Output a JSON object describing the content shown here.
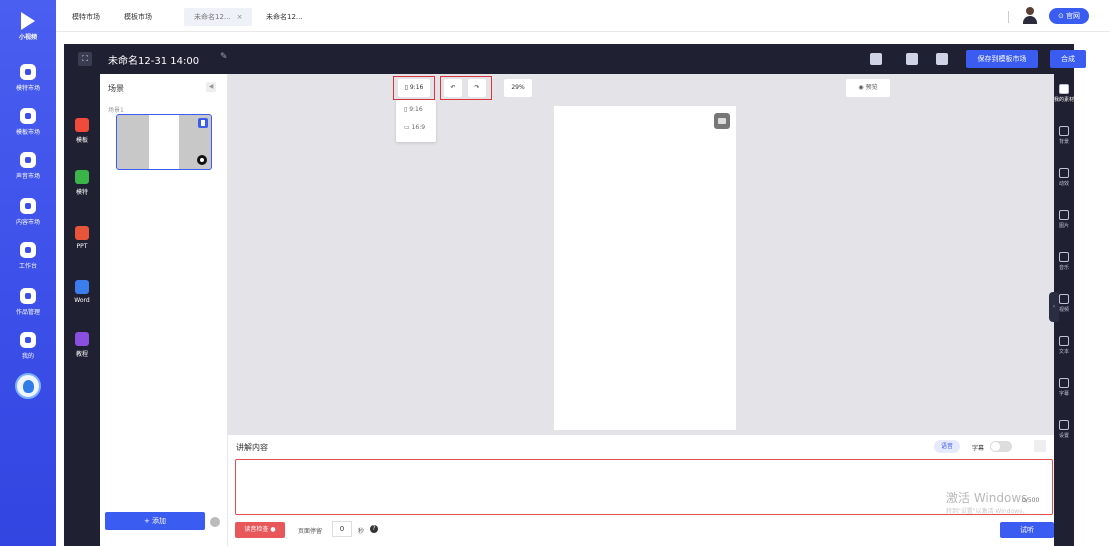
{
  "left_nav": {
    "logo_text": "小视频",
    "items": [
      {
        "label": "模特市场",
        "icon": "model-icon"
      },
      {
        "label": "模板市场",
        "icon": "template-icon"
      },
      {
        "label": "声音市场",
        "icon": "voice-icon"
      },
      {
        "label": "内容市场",
        "icon": "content-icon"
      },
      {
        "label": "工作台",
        "icon": "workbench-icon"
      },
      {
        "label": "作品管理",
        "icon": "works-icon"
      },
      {
        "label": "我的",
        "icon": "profile-icon"
      }
    ]
  },
  "tabs": [
    {
      "label": "模特市场"
    },
    {
      "label": "模板市场"
    },
    {
      "label": "未命名12...",
      "close": "×",
      "active": true
    },
    {
      "label": "未命名12..."
    }
  ],
  "header": {
    "official_label": "官网"
  },
  "editor": {
    "title": "未命名12-31 14:00",
    "save_label": "保存到模板市场",
    "compose_label": "合成"
  },
  "categories": [
    {
      "label": "模板",
      "color": "#f04b3a"
    },
    {
      "label": "模特",
      "color": "#3bb54a"
    },
    {
      "label": "PPT",
      "color": "#e8543a"
    },
    {
      "label": "Word",
      "color": "#3b7ded"
    },
    {
      "label": "教程",
      "color": "#8a4fe0"
    }
  ],
  "scenes": {
    "title": "场景",
    "scene_label": "场景1",
    "add_label": "+ 添加"
  },
  "canvas": {
    "ratio_current": "9:16",
    "ratio_options": [
      "9:16",
      "16:9"
    ],
    "zoom": "29%",
    "preview_label": "预览"
  },
  "narration": {
    "title": "讲解内容",
    "voice_label": "语音",
    "subtitle_label": "字幕",
    "counter": "0/500",
    "watermark_line1": "激活 Windows",
    "watermark_line2": "转到\"设置\"以激活 Windows。",
    "check_label": "读音检查",
    "pause_label": "页面停留",
    "pause_value": "0",
    "seconds_label": "秒",
    "listen_label": "试听"
  },
  "right_panel": {
    "items": [
      {
        "label": "我的素材",
        "active": true
      },
      {
        "label": "背景"
      },
      {
        "label": "动效"
      },
      {
        "label": "图片"
      },
      {
        "label": "音乐"
      },
      {
        "label": "视频"
      },
      {
        "label": "文本"
      },
      {
        "label": "字幕"
      },
      {
        "label": "设置"
      }
    ]
  },
  "colors": {
    "accent": "#3a5cf0",
    "sidebar": "#3b4ee8",
    "editor_bg": "#1f2132",
    "alert": "#e8585a",
    "annotation_red": "#d9363e"
  }
}
